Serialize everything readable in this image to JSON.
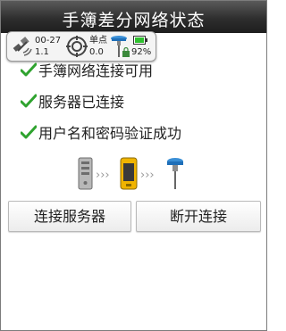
{
  "window": {
    "title": "手簿差分网络状态"
  },
  "status_bar": {
    "time_top": "00-27",
    "time_bottom": "1.1",
    "solution_top": "单点",
    "solution_bottom": "0.0",
    "battery_percent": "92%"
  },
  "status_messages": [
    "手簿网络连接可用",
    "服务器已连接",
    "用户名和密码验证成功"
  ],
  "buttons": {
    "connect_server": "连接服务器",
    "disconnect": "断开连接"
  },
  "colors": {
    "check": "#2fa32f",
    "titlebar": "#2e2e2e",
    "device_yellow": "#f0b400"
  },
  "icons": [
    "satellite-icon",
    "target-icon",
    "antenna-icon",
    "battery-icon",
    "check-icon",
    "server-icon",
    "phone-icon",
    "rover-antenna-icon"
  ]
}
